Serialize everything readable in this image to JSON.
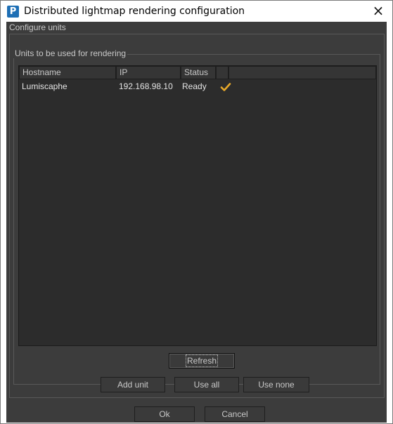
{
  "window": {
    "title": "Distributed lightmap rendering configuration",
    "app_icon_letter": "P",
    "close_glyph": "×"
  },
  "groups": {
    "configure_units": "Configure units",
    "units_for_rendering": "Units to be used for rendering"
  },
  "table": {
    "columns": [
      "Hostname",
      "IP",
      "Status",
      "",
      ""
    ],
    "rows": [
      {
        "hostname": "Lumiscaphe",
        "ip": "192.168.98.10",
        "status": "Ready",
        "selected_icon": "checkmark-icon"
      }
    ]
  },
  "buttons": {
    "refresh": "Refresh",
    "add_unit": "Add unit",
    "use_all": "Use all",
    "use_none": "Use none",
    "ok": "Ok",
    "cancel": "Cancel"
  },
  "colors": {
    "accent_check": "#e8a92a",
    "panel_bg": "#3c3c3c",
    "app_icon": "#1e6fb5"
  }
}
